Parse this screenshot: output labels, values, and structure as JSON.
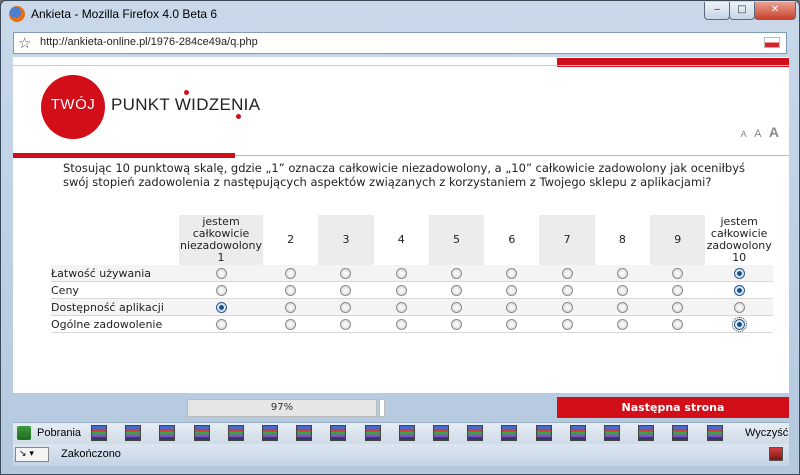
{
  "window": {
    "title": "Ankieta - Mozilla Firefox 4.0 Beta 6",
    "minimize_glyph": "‒",
    "maximize_glyph": "□",
    "close_glyph": "✕"
  },
  "urlbar": {
    "url": "http://ankieta-online.pl/1976-284ce49a/q.php"
  },
  "logo": {
    "circle_text": "TWÓJ",
    "text": "PUNKT WIDZENIA"
  },
  "font_size_switcher": [
    "A",
    "A",
    "A"
  ],
  "question": "Stosując 10 punktową skalę, gdzie „1” oznacza całkowicie niezadowolony, a „10” całkowicie zadowolony jak oceniłbyś swój stopień zadowolenia z następujących aspektów związanych z korzystaniem z Twojego sklepu z aplikacjami?",
  "matrix": {
    "columns": [
      "jestem całkowicie niezadowolony 1",
      "2",
      "3",
      "4",
      "5",
      "6",
      "7",
      "8",
      "9",
      "jestem całkowicie zadowolony 10"
    ],
    "rows": [
      {
        "label": "Łatwość używania",
        "selected": 10
      },
      {
        "label": "Ceny",
        "selected": 10
      },
      {
        "label": "Dostępność aplikacji",
        "selected": 1
      },
      {
        "label": "Ogólne zadowolenie",
        "selected": 10,
        "focused": true
      }
    ]
  },
  "progress": {
    "value": 97,
    "label": "97%"
  },
  "next_button": "Następna strona",
  "downloads_bar": {
    "label": "Pobrania",
    "clear_label": "Wyczyść",
    "item_count": 19
  },
  "statusbar": {
    "addon_glyph": "↘ ▾",
    "text": "Zakończono"
  },
  "colors": {
    "brand_red": "#d20e19"
  }
}
